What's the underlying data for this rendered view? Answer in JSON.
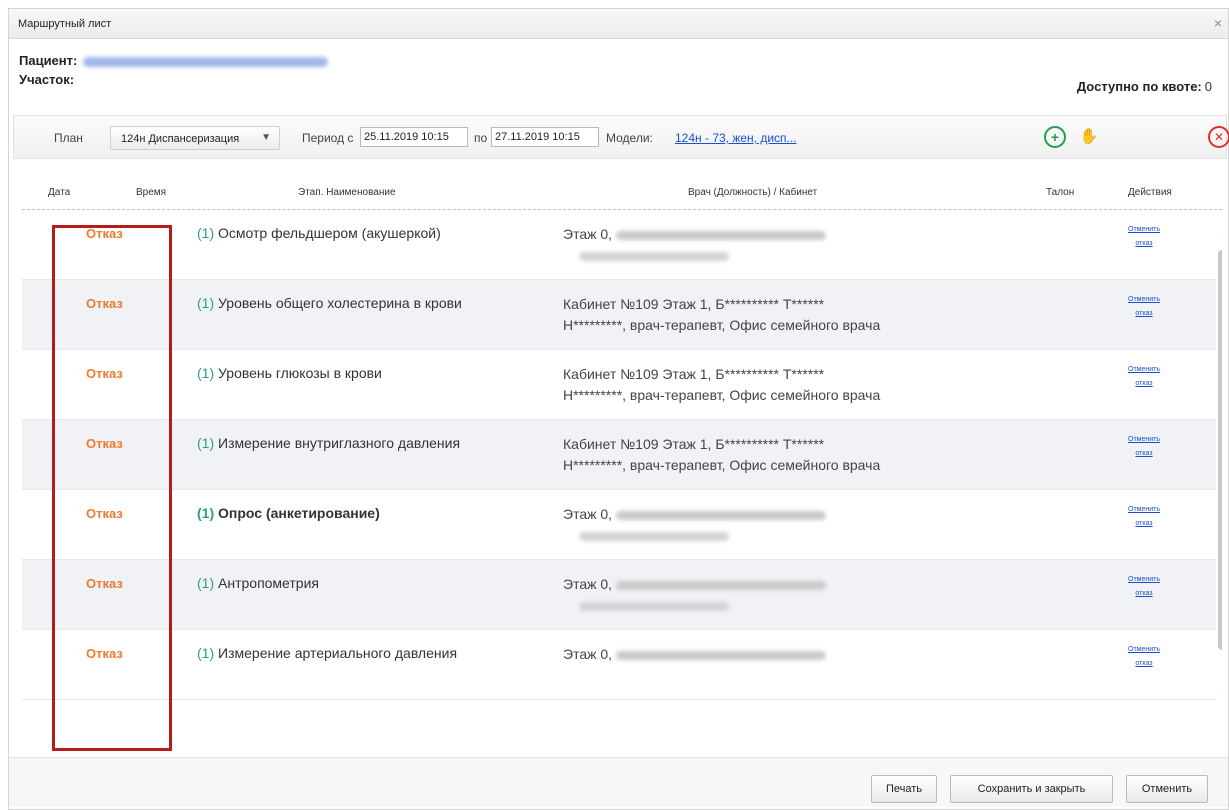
{
  "window": {
    "title": "Маршрутный лист",
    "close_icon": "×"
  },
  "patient": {
    "label": "Пациент:",
    "area_label": "Участок:"
  },
  "quota": {
    "label": "Доступно по квоте:",
    "value": "0"
  },
  "filters": {
    "plan_label": "План",
    "plan_value": "124н Диспансеризация",
    "period_label": "Период с",
    "period_from": "25.11.2019 10:15",
    "to_label": "по",
    "period_to": "27.11.2019 10:15",
    "models_label": "Модели:",
    "models_link": "124н - 73, жен, дисп..."
  },
  "icons": {
    "add": "add-icon",
    "hand": "hand-icon",
    "cancel": "cancel-icon"
  },
  "table": {
    "headers": {
      "date": "Дата",
      "time": "Время",
      "stage": "Этап. Наименование",
      "doctor": "Врач (Должность) / Кабинет",
      "ticket": "Талон",
      "actions": "Действия"
    },
    "rows": [
      {
        "status": "Отказ",
        "num": "(1)",
        "name": "Осмотр фельдшером (акушеркой)",
        "doc_line1": "Этаж 0,",
        "doc_line2": "",
        "action_1": "Отменить",
        "action_2": "отказ"
      },
      {
        "status": "Отказ",
        "num": "(1)",
        "name": "Уровень общего холестерина в крови",
        "doc_line1": "Кабинет №109 Этаж 1, Б********** Т******",
        "doc_line2": "Н*********, врач-терапевт, Офис семейного врача",
        "action_1": "Отменить",
        "action_2": "отказ"
      },
      {
        "status": "Отказ",
        "num": "(1)",
        "name": "Уровень глюкозы в крови",
        "doc_line1": "Кабинет №109 Этаж 1, Б********** Т******",
        "doc_line2": "Н*********, врач-терапевт, Офис семейного врача",
        "action_1": "Отменить",
        "action_2": "отказ"
      },
      {
        "status": "Отказ",
        "num": "(1)",
        "name": "Измерение внутриглазного давления",
        "doc_line1": "Кабинет №109 Этаж 1, Б********** Т******",
        "doc_line2": "Н*********, врач-терапевт, Офис семейного врача",
        "action_1": "Отменить",
        "action_2": "отказ"
      },
      {
        "status": "Отказ",
        "num": "(1)",
        "name": "Опрос (анкетирование)",
        "doc_line1": "Этаж 0,",
        "doc_line2": "",
        "action_1": "Отменить",
        "action_2": "отказ"
      },
      {
        "status": "Отказ",
        "num": "(1)",
        "name": "Антропометрия",
        "doc_line1": "Этаж 0,",
        "doc_line2": "",
        "action_1": "Отменить",
        "action_2": "отказ"
      },
      {
        "status": "Отказ",
        "num": "(1)",
        "name": "Измерение артериального давления",
        "doc_line1": "Этаж 0,",
        "doc_line2": "",
        "action_1": "Отменить",
        "action_2": "отказ"
      }
    ]
  },
  "footer": {
    "print": "Печать",
    "save_close": "Сохранить и закрыть",
    "cancel": "Отменить"
  }
}
